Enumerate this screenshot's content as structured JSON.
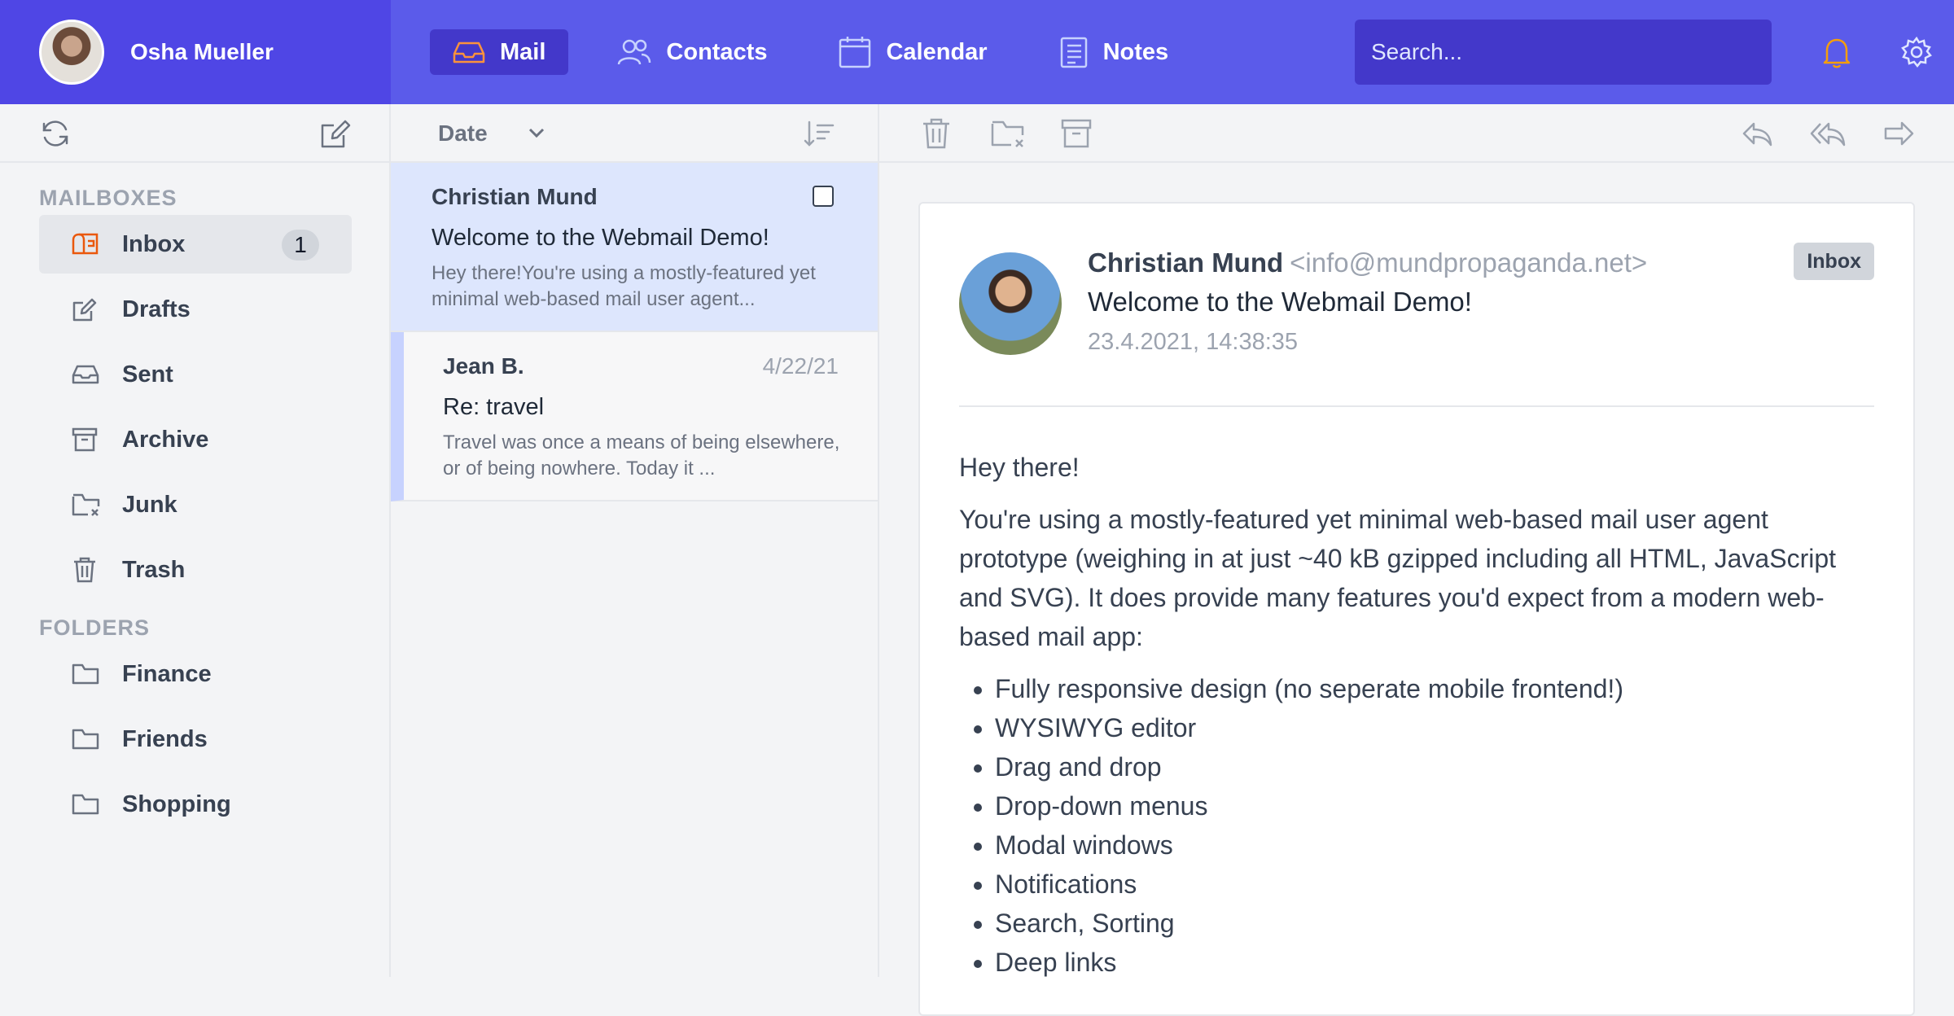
{
  "user": {
    "name": "Osha Mueller"
  },
  "nav": {
    "tabs": [
      {
        "label": "Mail",
        "icon": "inbox-icon",
        "active": true
      },
      {
        "label": "Contacts",
        "icon": "users-icon"
      },
      {
        "label": "Calendar",
        "icon": "calendar-icon"
      },
      {
        "label": "Notes",
        "icon": "notes-icon"
      }
    ],
    "search_placeholder": "Search...",
    "bell_color": "#f59e0b"
  },
  "list_toolbar": {
    "sort_label": "Date"
  },
  "sidebar": {
    "mailboxes_title": "MAILBOXES",
    "mailboxes": [
      {
        "label": "Inbox",
        "icon": "inbox-tray-icon",
        "badge": "1",
        "active": true
      },
      {
        "label": "Drafts",
        "icon": "edit-icon"
      },
      {
        "label": "Sent",
        "icon": "sent-tray-icon"
      },
      {
        "label": "Archive",
        "icon": "archive-icon"
      },
      {
        "label": "Junk",
        "icon": "junk-folder-icon"
      },
      {
        "label": "Trash",
        "icon": "trash-icon"
      }
    ],
    "folders_title": "FOLDERS",
    "folders": [
      {
        "label": "Finance",
        "icon": "folder-icon"
      },
      {
        "label": "Friends",
        "icon": "folder-icon"
      },
      {
        "label": "Shopping",
        "icon": "folder-icon"
      }
    ]
  },
  "messages": [
    {
      "from": "Christian Mund",
      "subject": "Welcome to the Webmail Demo!",
      "preview": "Hey there!You're using a mostly-featured yet minimal web-based mail user agent...",
      "selected": true
    },
    {
      "from": "Jean B.",
      "date": "4/22/21",
      "subject": "Re: travel",
      "preview": "Travel was once a means of being elsewhere, or of being nowhere. Today it ..."
    }
  ],
  "reader": {
    "sender_name": "Christian Mund",
    "sender_email": "<info@mundpropaganda.net>",
    "subject": "Welcome to the Webmail Demo!",
    "date": "23.4.2021, 14:38:35",
    "tag": "Inbox",
    "greeting": "Hey there!",
    "intro": "You're using a mostly-featured yet minimal web-based mail user agent prototype (weighing in at just ~40 kB gzipped including all HTML, JavaScript and SVG). It does provide many features you'd expect from a modern web-based mail app:",
    "features": [
      "Fully responsive design (no seperate mobile frontend!)",
      "WYSIWYG editor",
      "Drag and drop",
      "Drop-down menus",
      "Modal windows",
      "Notifications",
      "Search, Sorting",
      "Deep links"
    ]
  }
}
